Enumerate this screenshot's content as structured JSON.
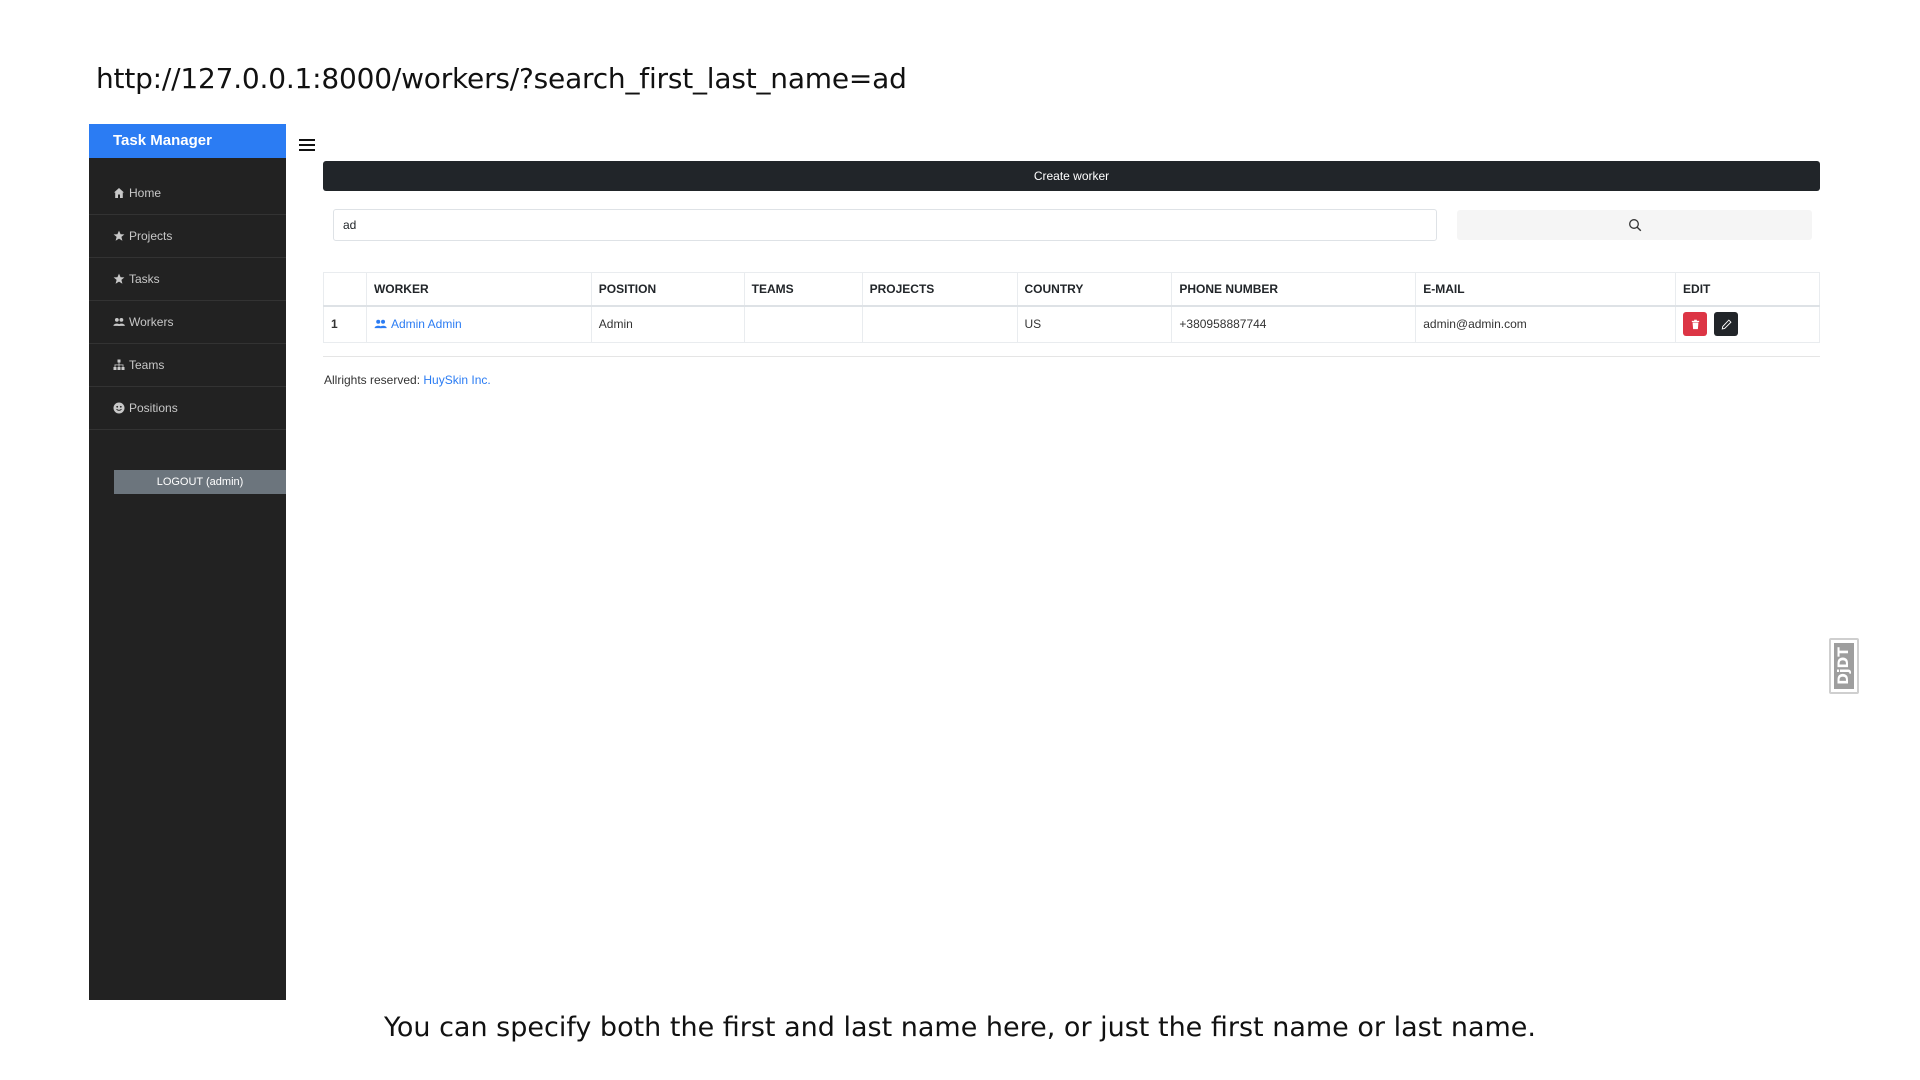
{
  "url": "http://127.0.0.1:8000/workers/?search_first_last_name=ad",
  "caption": "You can specify both the first and last name here, or just the first name or last name.",
  "sidebar": {
    "brand": "Task Manager",
    "items": [
      {
        "label": "Home",
        "icon": "home-icon"
      },
      {
        "label": "Projects",
        "icon": "star-icon"
      },
      {
        "label": "Tasks",
        "icon": "star-icon"
      },
      {
        "label": "Workers",
        "icon": "users-icon"
      },
      {
        "label": "Teams",
        "icon": "sitemap-icon"
      },
      {
        "label": "Positions",
        "icon": "smile-icon"
      }
    ],
    "logout_label": "LOGOUT (admin)"
  },
  "main": {
    "create_label": "Create worker",
    "search_value": "ad",
    "table": {
      "headers": [
        "",
        "WORKER",
        "POSITION",
        "TEAMS",
        "PROJECTS",
        "COUNTRY",
        "PHONE NUMBER",
        "E-MAIL",
        "EDIT"
      ],
      "rows": [
        {
          "num": "1",
          "worker": "Admin Admin",
          "position": "Admin",
          "teams": "",
          "projects": "",
          "country": "US",
          "phone": "+380958887744",
          "email": "admin@admin.com"
        }
      ]
    },
    "footer_text": "Allrights reserved:",
    "footer_link": "HuySkin Inc."
  },
  "debug_toolbar_label": "DjDT",
  "colors": {
    "brand": "#2b7cf3",
    "sidebar": "#222222",
    "delete": "#dc3545",
    "dark": "#212529"
  }
}
